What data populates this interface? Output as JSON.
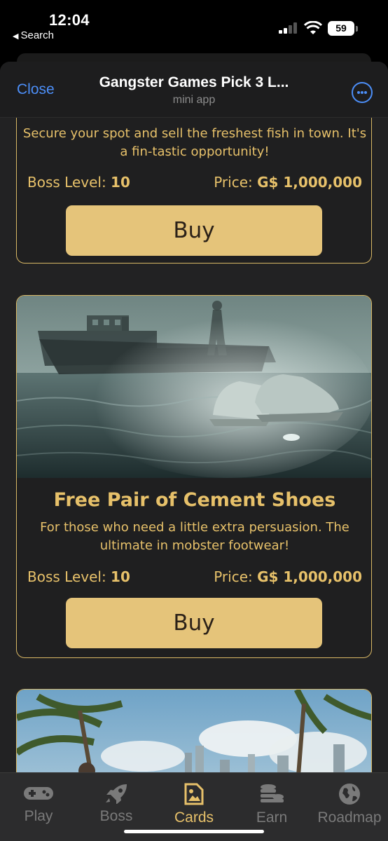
{
  "status": {
    "time": "12:04",
    "back_label": "Search",
    "battery": "59"
  },
  "nav": {
    "close_label": "Close",
    "title": "Gangster Games Pick 3 L...",
    "subtitle": "mini app"
  },
  "cards": [
    {
      "description": "Secure your spot and sell the freshest fish in town. It's a fin-tastic opportunity!",
      "level_label": "Boss Level: ",
      "level_value": "10",
      "price_label": "Price: ",
      "price_value": "G$ 1,000,000",
      "buy_label": "Buy"
    },
    {
      "image_icon": "cement-shoes-boat-image",
      "title": "Free Pair of Cement Shoes",
      "description": "For those who need a little extra persuasion. The ultimate in mobster footwear!",
      "level_label": "Boss Level: ",
      "level_value": "10",
      "price_label": "Price: ",
      "price_value": "G$ 1,000,000",
      "buy_label": "Buy"
    },
    {
      "image_icon": "palm-city-skyline-image"
    }
  ],
  "tabs": [
    {
      "label": "Play",
      "icon": "gamepad-icon",
      "active": false
    },
    {
      "label": "Boss",
      "icon": "rocket-icon",
      "active": false
    },
    {
      "label": "Cards",
      "icon": "image-card-icon",
      "active": true
    },
    {
      "label": "Earn",
      "icon": "coins-icon",
      "active": false
    },
    {
      "label": "Roadmap",
      "icon": "globe-icon",
      "active": false
    }
  ],
  "colors": {
    "accent_gold": "#e7c16a",
    "button_gold": "#e5c47a",
    "link_blue": "#4c8ef7",
    "background": "#222223"
  }
}
